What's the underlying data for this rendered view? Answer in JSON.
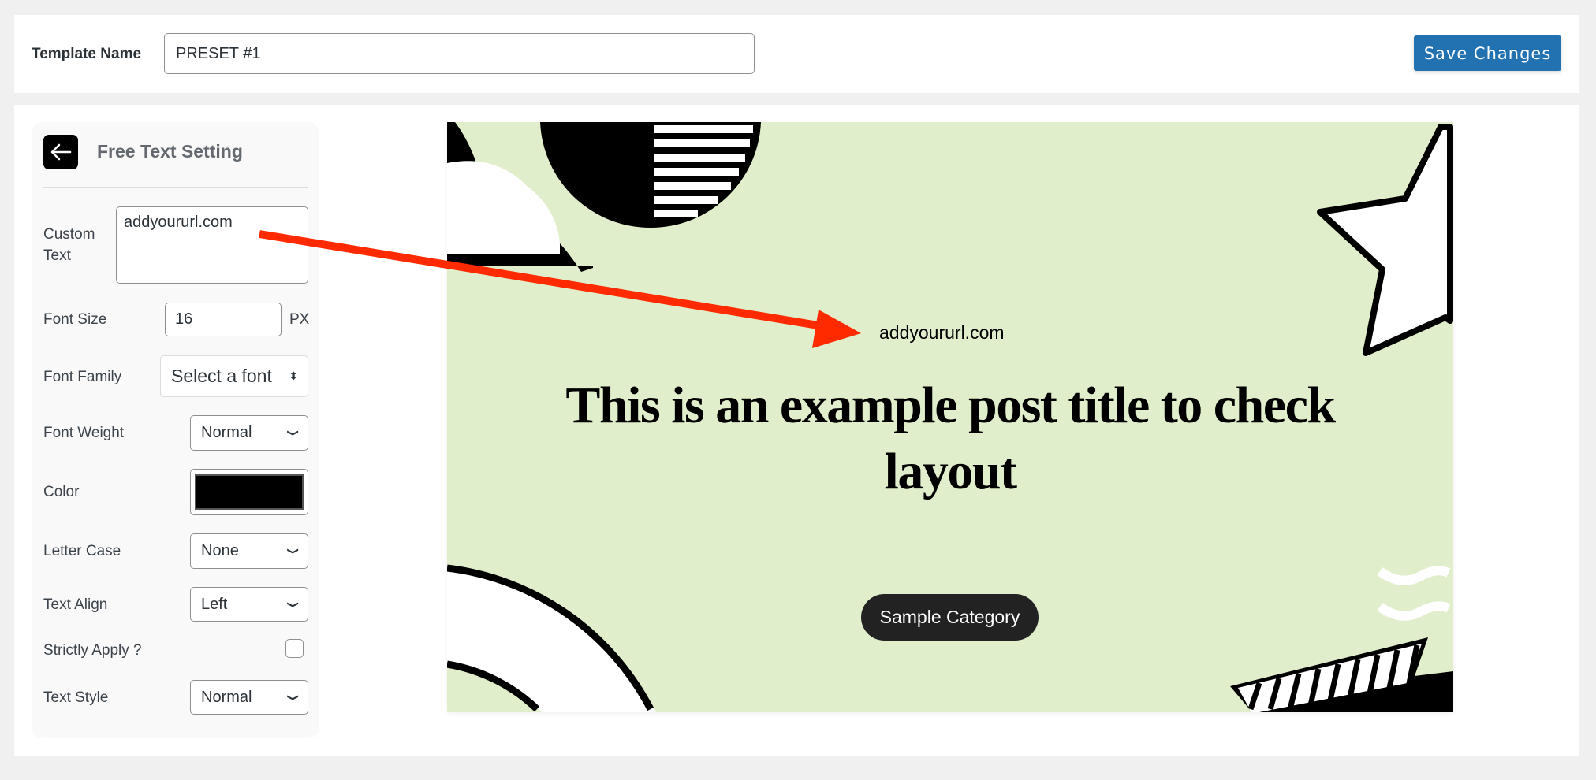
{
  "header": {
    "template_name_label": "Template Name",
    "template_name_value": "PRESET #1",
    "save_label": "Save Changes"
  },
  "sidebar": {
    "title": "Free Text Setting",
    "custom_text_label_1": "Custom",
    "custom_text_label_2": "Text",
    "custom_text_value": "addyoururl.com",
    "font_size_label": "Font Size",
    "font_size_value": "16",
    "font_size_unit": "PX",
    "font_family_label": "Font Family",
    "font_family_value": "Select a font",
    "font_weight_label": "Font Weight",
    "font_weight_value": "Normal",
    "color_label": "Color",
    "color_value": "#000000",
    "letter_case_label": "Letter Case",
    "letter_case_value": "None",
    "text_align_label": "Text Align",
    "text_align_value": "Left",
    "strictly_apply_label": "Strictly Apply ?",
    "strictly_apply_checked": false,
    "text_style_label": "Text Style",
    "text_style_value": "Normal"
  },
  "preview": {
    "free_text": "addyoururl.com",
    "post_title": "This is an example post title to check layout",
    "category": "Sample Category",
    "background_color": "#e0eecb"
  },
  "annotation": {
    "arrow_color": "#ff2a00"
  }
}
